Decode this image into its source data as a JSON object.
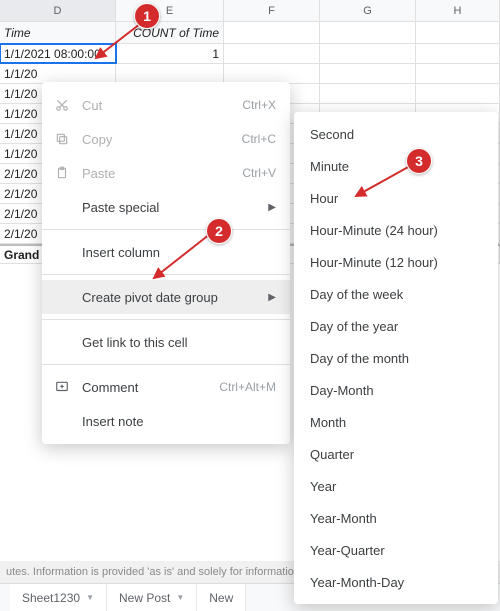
{
  "columns": {
    "D": "D",
    "E": "E",
    "F": "F",
    "G": "G",
    "H": "H"
  },
  "pivot": {
    "time_header": "Time",
    "count_header": "COUNT of Time",
    "rows": [
      {
        "t": "1/1/2021 08:00:00",
        "c": "1"
      },
      {
        "t": "1/1/20",
        "c": ""
      },
      {
        "t": "1/1/20",
        "c": ""
      },
      {
        "t": "1/1/20",
        "c": ""
      },
      {
        "t": "1/1/20",
        "c": ""
      },
      {
        "t": "1/1/20",
        "c": ""
      },
      {
        "t": "2/1/20",
        "c": ""
      },
      {
        "t": "2/1/20",
        "c": ""
      },
      {
        "t": "2/1/20",
        "c": ""
      },
      {
        "t": "2/1/20",
        "c": ""
      }
    ],
    "grand_label": "Grand"
  },
  "context": {
    "cut": "Cut",
    "cut_k": "Ctrl+X",
    "copy": "Copy",
    "copy_k": "Ctrl+C",
    "paste": "Paste",
    "paste_k": "Ctrl+V",
    "paste_special": "Paste special",
    "insert_col": "Insert column",
    "create_group": "Create pivot date group",
    "get_link": "Get link to this cell",
    "comment": "Comment",
    "comment_k": "Ctrl+Alt+M",
    "insert_note": "Insert note"
  },
  "submenu": {
    "items": [
      "Second",
      "Minute",
      "Hour",
      "Hour-Minute (24 hour)",
      "Hour-Minute (12 hour)",
      "Day of the week",
      "Day of the year",
      "Day of the month",
      "Day-Month",
      "Month",
      "Quarter",
      "Year",
      "Year-Month",
      "Year-Quarter",
      "Year-Month-Day"
    ]
  },
  "disclaimer": "utes. Information is provided 'as is' and solely for informatio",
  "tabs": {
    "a": "Sheet1230",
    "b": "New Post",
    "c": "New"
  },
  "callouts": {
    "one": "1",
    "two": "2",
    "three": "3"
  }
}
